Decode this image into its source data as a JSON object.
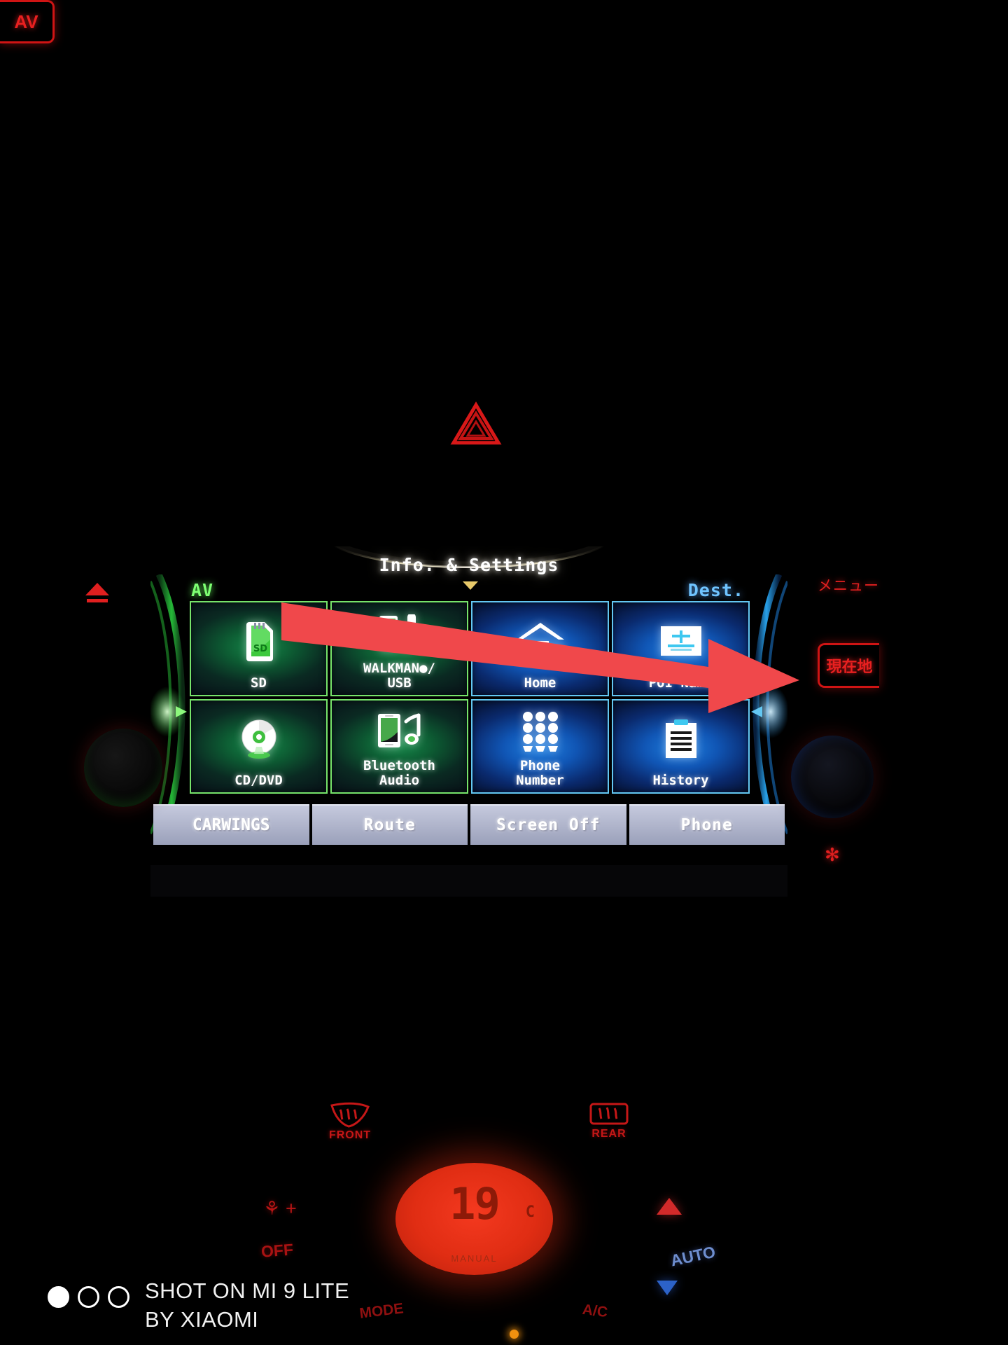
{
  "head_unit": {
    "title": "Info. & Settings",
    "section_left_label": "AV",
    "section_right_label": "Dest.",
    "tiles": [
      {
        "label": "SD",
        "group": "av",
        "icon": "sd-card-icon"
      },
      {
        "label": "WALKMAN●/\nUSB",
        "group": "av",
        "icon": "walkman-usb-icon"
      },
      {
        "label": "Home",
        "group": "dest",
        "icon": "house-icon"
      },
      {
        "label": "POI Name",
        "group": "dest",
        "icon": "poi-name-icon"
      },
      {
        "label": "CD/DVD",
        "group": "av",
        "icon": "disc-icon"
      },
      {
        "label": "Bluetooth\nAudio",
        "group": "av",
        "icon": "bluetooth-audio-icon"
      },
      {
        "label": "Phone\nNumber",
        "group": "dest",
        "icon": "keypad-icon"
      },
      {
        "label": "History",
        "group": "dest",
        "icon": "list-document-icon"
      }
    ],
    "function_bar": [
      {
        "label": "CARWINGS"
      },
      {
        "label": "Route"
      },
      {
        "label": "Screen Off"
      },
      {
        "label": "Phone"
      }
    ]
  },
  "hardware": {
    "eject_label": "▲",
    "av_button": "AV",
    "menu_button": "メニュー",
    "current_location_button": "現在地",
    "settings_glyph": "✻"
  },
  "hazard": {
    "name": "hazard-warning-triangle"
  },
  "climate": {
    "defrost_front": "FRONT",
    "defrost_rear": "REAR",
    "fan_up": "⚘ +",
    "fan_off": "OFF",
    "temperature": "19",
    "temperature_unit": "C",
    "display_mode": "MANUAL",
    "mode_button": "MODE",
    "ac_button": "A/C",
    "auto_button": "AUTO"
  },
  "watermark": {
    "line1": "SHOT ON MI 9 LITE",
    "line2": "BY XIAOMI",
    "dots": 3
  },
  "colors": {
    "av_accent": "#76e36a",
    "dest_accent": "#63c7f2",
    "hardware_red": "#e01f1f",
    "arrow_red": "#f04a4a",
    "climate_red": "#c51717"
  }
}
